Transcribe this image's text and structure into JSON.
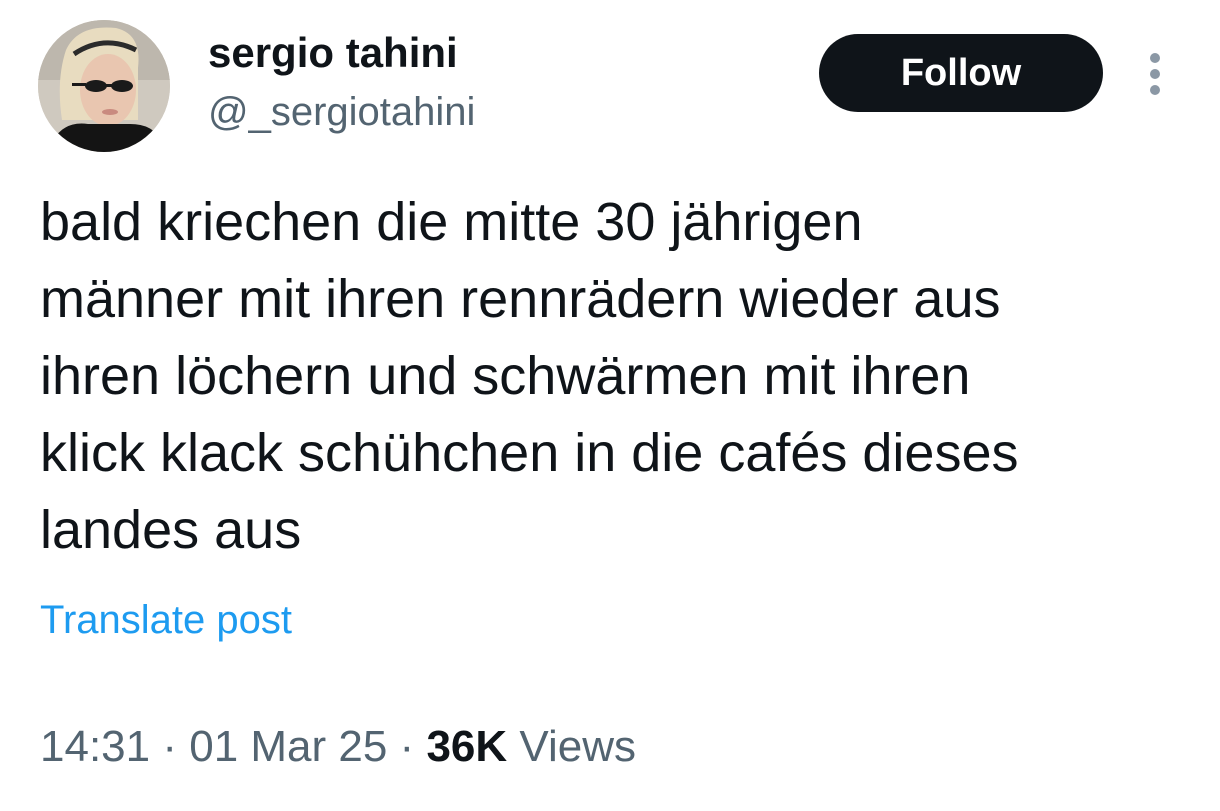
{
  "author": {
    "display_name": "sergio tahini",
    "handle": "@_sergiotahini",
    "avatar_icon": "profile-photo"
  },
  "actions": {
    "follow_label": "Follow",
    "more_icon": "vertical-ellipsis-icon"
  },
  "post": {
    "text": "bald kriechen die mitte 30 jährigen\nmänner mit ihren rennrädern wieder aus\nihren löchern und schwärmen mit ihren\nklick klack schühchen in die cafés dieses\nlandes aus",
    "translate_label": "Translate post"
  },
  "meta": {
    "time": "14:31",
    "separator": " · ",
    "date": "01 Mar 25",
    "views_count": "36K",
    "views_label": "Views"
  },
  "colors": {
    "text": "#0f1419",
    "secondary": "#536471",
    "link": "#1d9bf0",
    "button_bg": "#0f1419"
  }
}
